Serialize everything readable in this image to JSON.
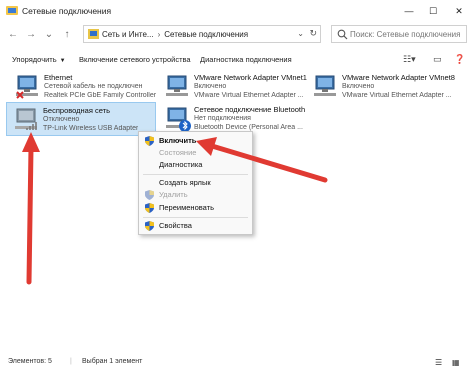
{
  "window": {
    "title": "Сетевые подключения",
    "minimize": "—",
    "maximize": "☐",
    "close": "✕"
  },
  "nav": {
    "back": "←",
    "forward": "→",
    "down": "⌄",
    "up": "↑",
    "breadcrumbs": [
      "Сеть и Инте...",
      "Сетевые подключения"
    ],
    "breadcrumb_sep": "›",
    "search_placeholder": "Поиск: Сетевые подключения"
  },
  "toolbar": {
    "organize": "Упорядочить",
    "enable_device": "Включение сетевого устройства",
    "diagnose": "Диагностика подключения"
  },
  "items": [
    {
      "name": "Ethernet",
      "status": "Сетевой кабель не подключен",
      "device": "Realtek PCIe GbE Family Controller"
    },
    {
      "name": "VMware Network Adapter VMnet1",
      "status": "Включено",
      "device": "VMware Virtual Ethernet Adapter ..."
    },
    {
      "name": "VMware Network Adapter VMnet8",
      "status": "Включено",
      "device": "VMware Virtual Ethernet Adapter ..."
    },
    {
      "name": "Беспроводная сеть",
      "status": "Отключено",
      "device": "TP-Link Wireless USB Adapter"
    },
    {
      "name": "Сетевое подключение Bluetooth",
      "status": "Нет подключения",
      "device": "Bluetooth Device (Personal Area ..."
    }
  ],
  "context_menu": {
    "enable": "Включить",
    "status": "Состояние",
    "diagnose": "Диагностика",
    "create_shortcut": "Создать ярлык",
    "delete": "Удалить",
    "rename": "Переименовать",
    "properties": "Свойства"
  },
  "statusbar": {
    "count": "Элементов: 5",
    "selected": "Выбран 1 элемент"
  },
  "colors": {
    "selection": "#cce4f7",
    "arrow": "#e03a32"
  }
}
